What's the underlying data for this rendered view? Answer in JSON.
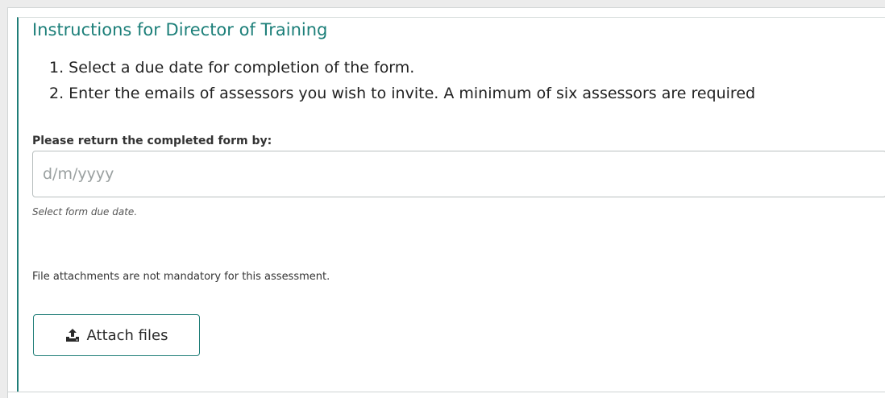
{
  "panel": {
    "title": "Instructions for Director of Training",
    "accent_color": "#1f7d77",
    "instructions": [
      "1. Select a due date for completion of the form.",
      "2. Enter the emails of assessors you wish to invite. A minimum of six assessors are required"
    ]
  },
  "due_date": {
    "label": "Please return the completed form by:",
    "value": "",
    "placeholder": "d/m/yyyy",
    "help": "Select form due date."
  },
  "attachments": {
    "note": "File attachments are not mandatory for this assessment.",
    "button_label": "Attach files",
    "button_icon": "upload-icon"
  }
}
